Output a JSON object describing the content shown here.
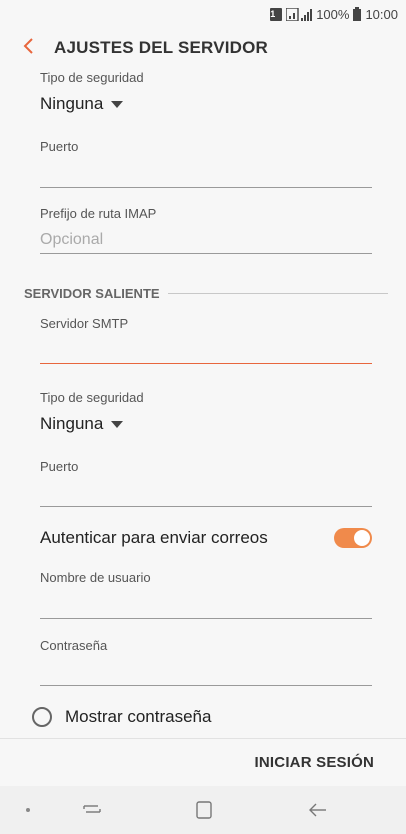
{
  "status_bar": {
    "sim": "1",
    "battery": "100%",
    "time": "10:00"
  },
  "app_bar": {
    "title": "AJUSTES DEL SERVIDOR"
  },
  "incoming": {
    "security_label": "Tipo de seguridad",
    "security_value": "Ninguna",
    "port_label": "Puerto",
    "port_value": "",
    "imap_prefix_label": "Prefijo de ruta IMAP",
    "imap_prefix_placeholder": "Opcional"
  },
  "outgoing": {
    "section_title": "SERVIDOR SALIENTE",
    "smtp_label": "Servidor SMTP",
    "smtp_value": "",
    "security_label": "Tipo de seguridad",
    "security_value": "Ninguna",
    "port_label": "Puerto",
    "port_value": "",
    "auth_label": "Autenticar para enviar correos",
    "auth_enabled": true,
    "username_label": "Nombre de usuario",
    "username_value": "",
    "password_label": "Contraseña",
    "password_value": "",
    "show_password_label": "Mostrar contraseña"
  },
  "actions": {
    "login_label": "INICIAR SESIÓN"
  },
  "colors": {
    "accent": "#e8663d",
    "toggle": "#f08a4b"
  }
}
